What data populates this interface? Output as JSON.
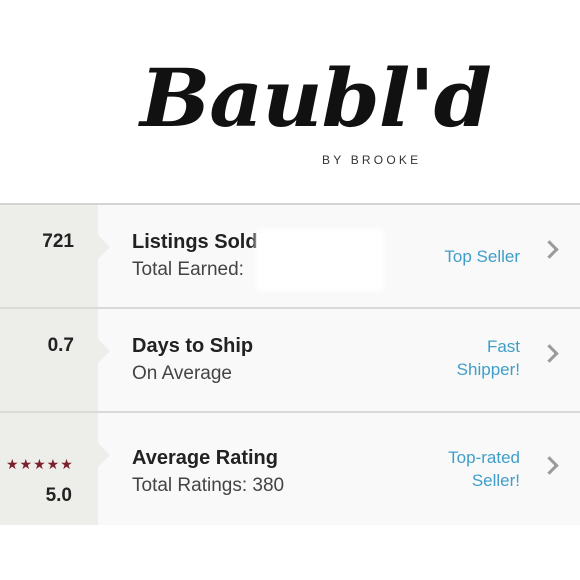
{
  "logo": {
    "name": "Baubl'd",
    "tagline": "BY BROOKE"
  },
  "stats": [
    {
      "value": "721",
      "title": "Listings Sold",
      "subtitle": "Total Earned:",
      "badge_line1": "Top Seller",
      "badge_line2": ""
    },
    {
      "value": "0.7",
      "title": "Days to Ship",
      "subtitle": "On Average",
      "badge_line1": "Fast",
      "badge_line2": "Shipper!"
    },
    {
      "value": "5.0",
      "stars": "★★★★★",
      "title": "Average Rating",
      "subtitle": "Total Ratings: 380",
      "badge_line1": "Top-rated",
      "badge_line2": "Seller!"
    }
  ],
  "rating_stars": 5,
  "colors": {
    "badge": "#3f9ec9",
    "stars": "#7a1f2b",
    "number_cell": "#ededea",
    "row_background": "#f9f9f9"
  },
  "icons": {
    "row_arrow": "chevron-right-icon",
    "rating": "star-icon"
  }
}
